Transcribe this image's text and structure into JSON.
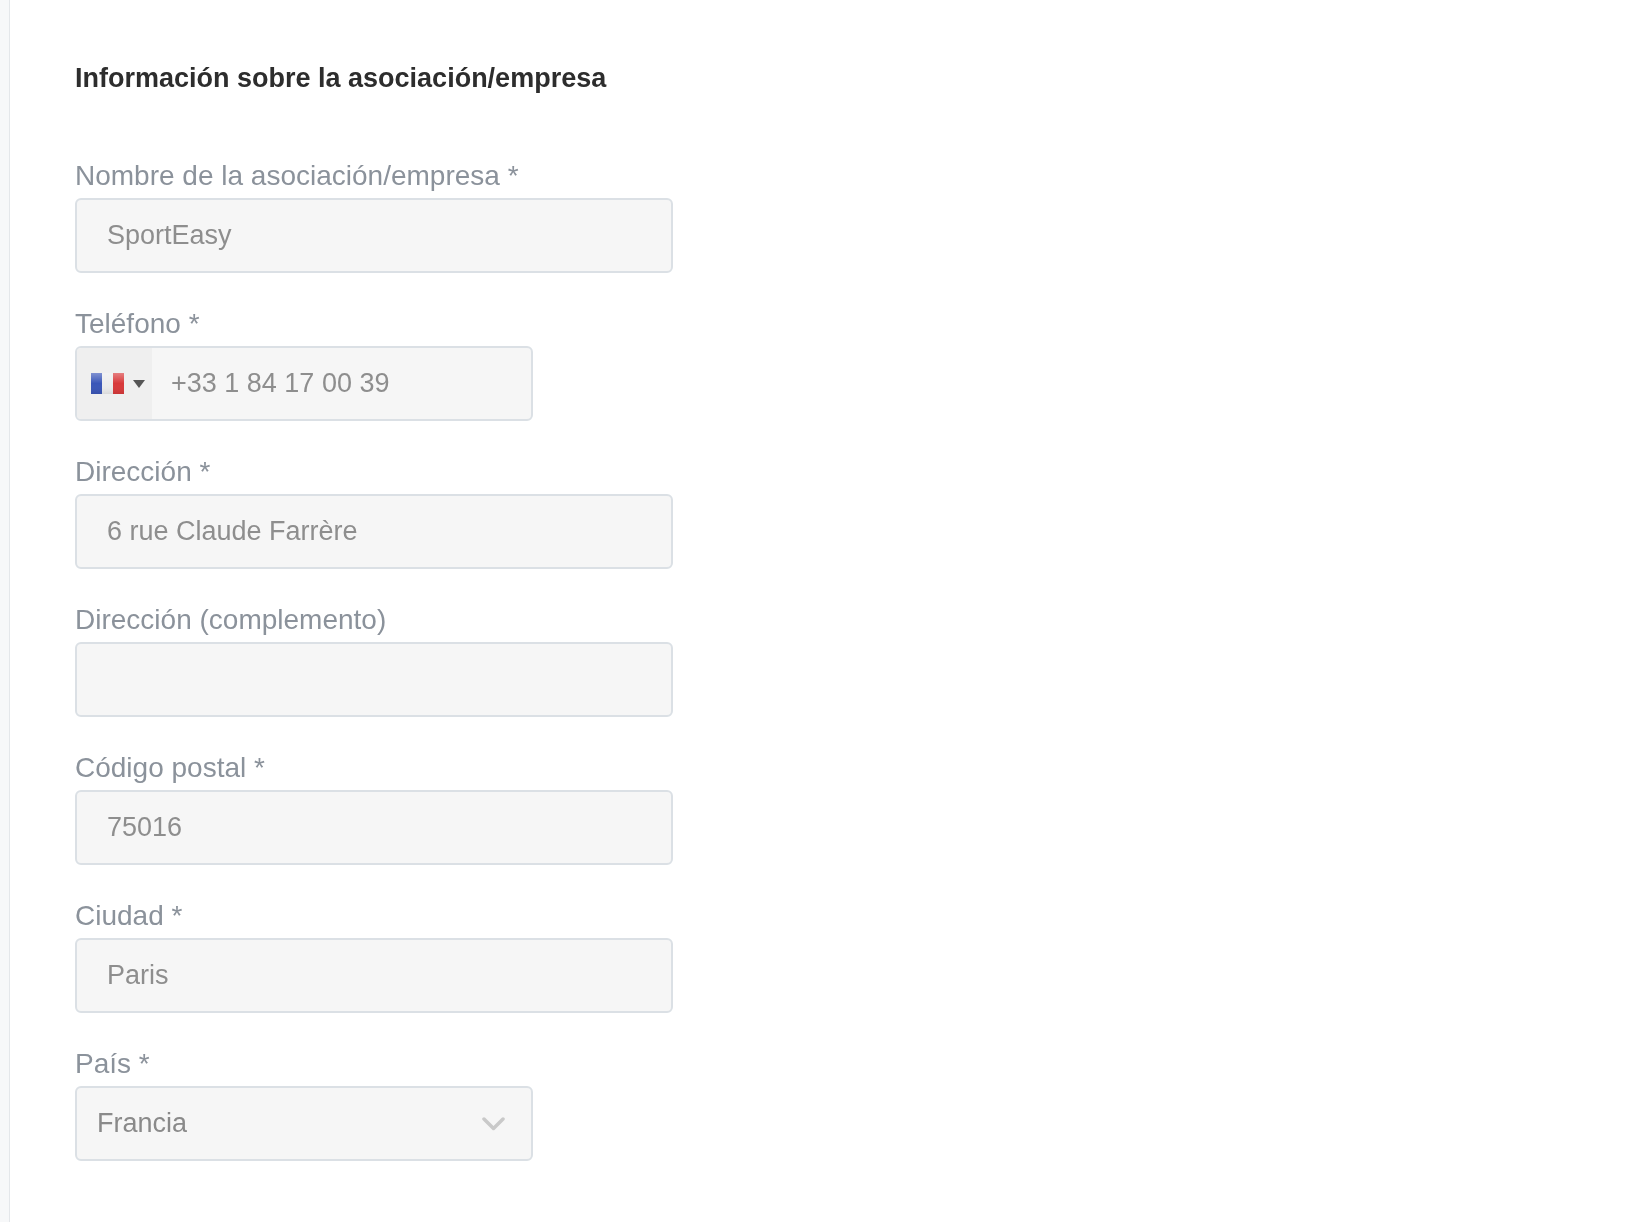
{
  "section": {
    "title": "Información sobre la asociación/empresa"
  },
  "fields": [
    {
      "kind": "text",
      "label": "Nombre de la asociación/empresa *",
      "value": "SportEasy"
    },
    {
      "kind": "phone",
      "label": "Teléfono *",
      "value": "+33 1 84 17 00 39"
    },
    {
      "kind": "text",
      "label": "Dirección *",
      "value": "6 rue Claude Farrère"
    },
    {
      "kind": "text",
      "label": "Dirección (complemento)"
    },
    {
      "kind": "text",
      "label": "Código postal *",
      "value": "75016"
    },
    {
      "kind": "text",
      "label": "Ciudad *",
      "value": "Paris"
    },
    {
      "kind": "select",
      "label": "País *",
      "value": "Francia"
    }
  ]
}
